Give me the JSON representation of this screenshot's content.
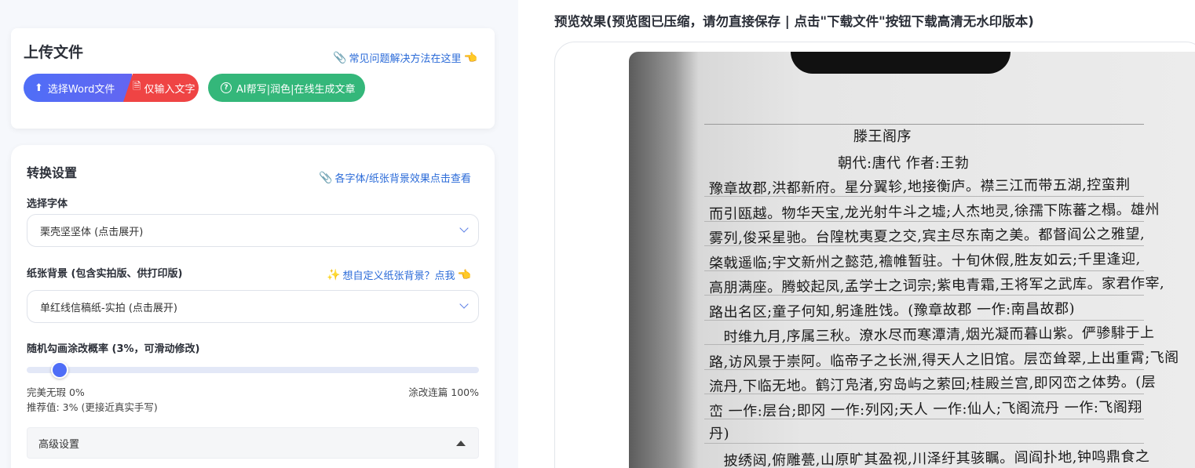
{
  "upload": {
    "title": "上传文件",
    "help_link": "常见问题解决方法在这里",
    "btn_word": "选择Word文件",
    "btn_text": "仅输入文字",
    "btn_ai": "AI帮写|润色|在线生成文章"
  },
  "settings": {
    "title": "转换设置",
    "fonts_link": "各字体/纸张背景效果点击查看",
    "font_label": "选择字体",
    "font_value": "栗壳坚坚体 (点击展开)",
    "paper_label": "纸张背景 (包含实拍版、供打印版)",
    "paper_custom_link": "想自定义纸张背景？点我",
    "paper_value": "单红线信稿纸-实拍 (点击展开)",
    "rate_label": "随机勾画涂改概率 (3%，可滑动修改)",
    "rate_value": 3,
    "min_label": "完美无瑕 0%",
    "max_label": "涂改连篇 100%",
    "recommend": "推荐值: 3% (更接近真实手写)",
    "advanced": "高级设置"
  },
  "preview": {
    "title": "预览效果(预览图已压缩，请勿直接保存 | 点击\"下载文件\"按钮下载高清无水印版本)"
  },
  "handwriting": {
    "heading": "滕王阁序",
    "subheading": "朝代:唐代 作者:王勃",
    "lines": [
      "豫章故郡,洪都新府。星分翼轸,地接衡庐。襟三江而带五湖,控蛮荆",
      "而引瓯越。物华天宝,龙光射牛斗之墟;人杰地灵,徐孺下陈蕃之榻。雄州",
      "雾列,俊采星驰。台隍枕夷夏之交,宾主尽东南之美。都督阎公之雅望,",
      "棨戟遥临;宇文新州之懿范,襜帷暂驻。十旬休假,胜友如云;千里逢迎,",
      "高朋满座。腾蛟起凤,孟学士之词宗;紫电青霜,王将军之武库。家君作宰,",
      "路出名区;童子何知,躬逢胜饯。(豫章故郡 一作:南昌故郡)",
      "　时维九月,序属三秋。潦水尽而寒潭清,烟光凝而暮山紫。俨骖騑于上",
      "路,访风景于崇阿。临帝子之长洲,得天人之旧馆。层峦耸翠,上出重霄;飞阁",
      "流丹,下临无地。鹤汀凫渚,穷岛屿之萦回;桂殿兰宫,即冈峦之体势。(层",
      "峦 一作:层台;即冈 一作:列冈;天人 一作:仙人;飞阁流丹 一作:飞阁翔",
      "丹)",
      "　披绣闼,俯雕甍,山原旷其盈视,川泽纡其骇瞩。闾阎扑地,钟鸣鼎食之"
    ]
  }
}
